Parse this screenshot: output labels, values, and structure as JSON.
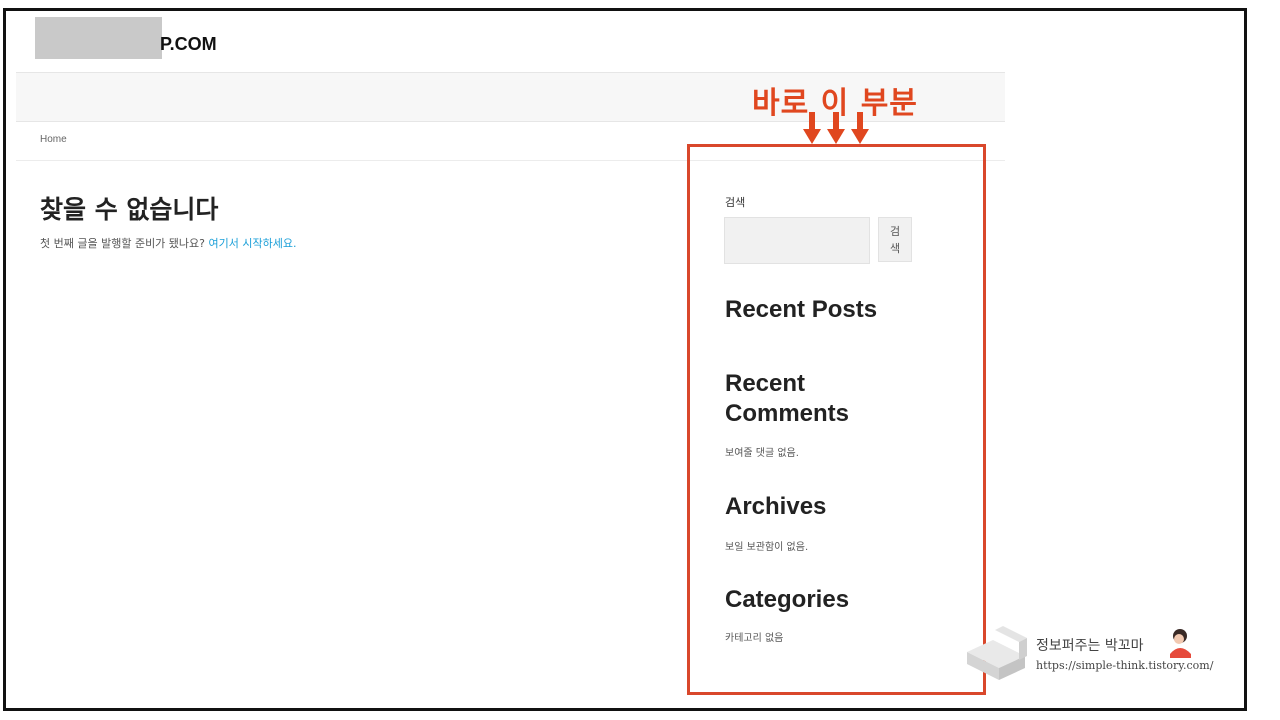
{
  "site": {
    "logo_suffix": "P.COM"
  },
  "breadcrumb": {
    "home": "Home"
  },
  "page": {
    "title": "찾을 수 없습니다",
    "desc_prefix": "첫 번째 글을 발행할 준비가 됐나요? ",
    "desc_link": "여기서 시작하세요."
  },
  "annotation": {
    "text": "바로 이 부분"
  },
  "sidebar": {
    "search_label": "검색",
    "search_button": "검색",
    "recent_posts_title": "Recent Posts",
    "recent_comments_title": "Recent Comments",
    "recent_comments_empty": "보여줄 댓글 없음.",
    "archives_title": "Archives",
    "archives_empty": "보일 보관함이 없음.",
    "categories_title": "Categories",
    "categories_empty": "카테고리 없음"
  },
  "watermark": {
    "name": "정보퍼주는 박꼬마",
    "url": "https://simple-think.tistory.com/"
  },
  "colors": {
    "accent": "#e0471f",
    "box": "#d9472b",
    "link": "#1a9fd8"
  }
}
